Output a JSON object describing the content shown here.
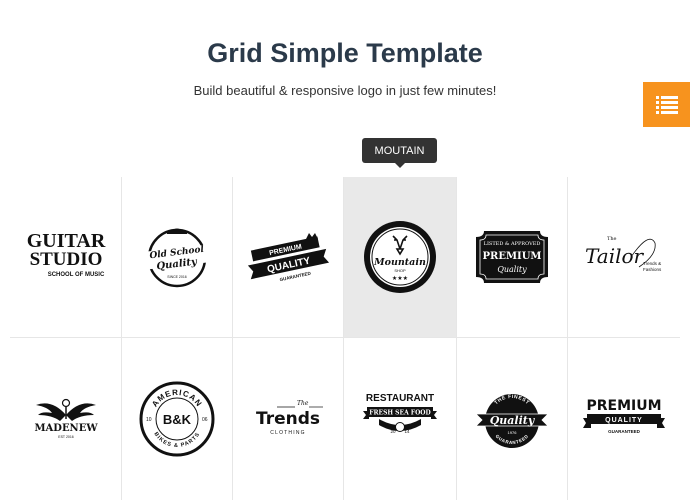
{
  "header": {
    "title": "Grid Simple Template",
    "subtitle": "Build beautiful & responsive logo in just few minutes!"
  },
  "menu_button": {
    "icon": "list-icon",
    "color": "#f7931e"
  },
  "tooltip": {
    "label": "MOUTAIN"
  },
  "colors": {
    "active_cell": "#e9e9e9",
    "title": "#2b3a4a",
    "accent": "#f7931e"
  },
  "logos": {
    "guitar_studio": {
      "line1": "GUITAR",
      "line2": "STUDIO",
      "tagline": "SCHOOL OF MUSIC"
    },
    "old_school": {
      "line1": "Old School",
      "line2": "Quality",
      "small": "SINCE 2016"
    },
    "premium_banner": {
      "top": "PREMIUM",
      "main": "QUALITY",
      "sub": "GUARANTEED"
    },
    "mountain": {
      "name": "Mountain",
      "sub": "SHOP",
      "stars": "★★★"
    },
    "premium_label": {
      "top": "LISTED & APPROVED",
      "main": "PREMIUM",
      "sub": "Quality"
    },
    "tailor": {
      "the": "The",
      "name": "Tailor",
      "sub1": "Trends &",
      "sub2": "Fashions"
    },
    "madenew": {
      "name": "MADENEW",
      "est": "EST 2016"
    },
    "american": {
      "top": "AMERICAN",
      "center": "B&K",
      "bottom": "BIKES & PARTS",
      "left": "10",
      "right": "06"
    },
    "trends": {
      "the": "The",
      "name": "Trends",
      "sub": "CLOTHING"
    },
    "restaurant": {
      "name": "RESTAURANT",
      "banner": "FRESH SEA FOOD",
      "year1": "20",
      "year2": "14"
    },
    "the_finest": {
      "top": "THE FINEST",
      "main": "Quality",
      "year": "1976",
      "bottom": "GUARANTEED"
    },
    "premium_quality": {
      "line1": "PREMIUM",
      "banner": "QUALITY",
      "sub": "GUARANTEED"
    }
  }
}
